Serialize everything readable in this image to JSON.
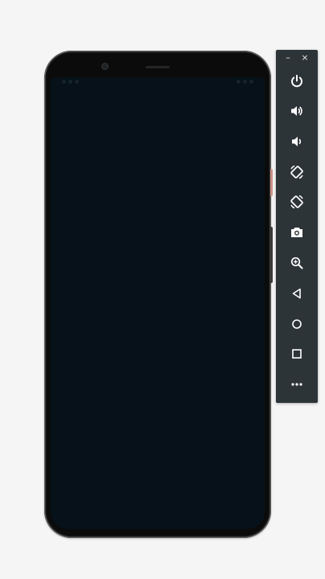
{
  "emulator": {
    "screen_color": "#061119",
    "frame_color": "#161616"
  },
  "toolbar": {
    "minimize_label": "–",
    "close_label": "×",
    "buttons": [
      {
        "name": "power-button",
        "icon": "power-icon"
      },
      {
        "name": "volume-up-button",
        "icon": "volume-up-icon"
      },
      {
        "name": "volume-down-button",
        "icon": "volume-down-icon"
      },
      {
        "name": "rotate-left-button",
        "icon": "rotate-left-icon"
      },
      {
        "name": "rotate-right-button",
        "icon": "rotate-right-icon"
      },
      {
        "name": "screenshot-button",
        "icon": "camera-icon"
      },
      {
        "name": "zoom-button",
        "icon": "zoom-in-icon"
      },
      {
        "name": "back-button",
        "icon": "back-triangle-icon"
      },
      {
        "name": "home-button",
        "icon": "home-circle-icon"
      },
      {
        "name": "overview-button",
        "icon": "overview-square-icon"
      },
      {
        "name": "more-button",
        "icon": "more-dots-icon"
      }
    ]
  }
}
